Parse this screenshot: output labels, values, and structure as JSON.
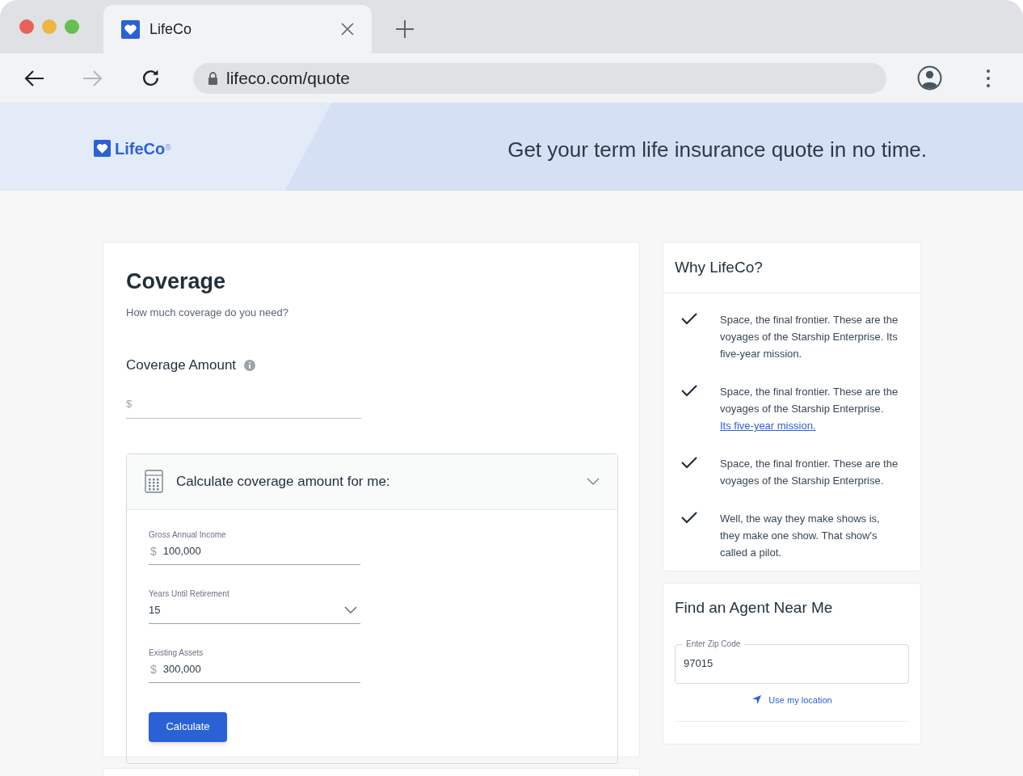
{
  "browser": {
    "tabs": [
      {
        "title": "LifeCo",
        "selected": true
      }
    ],
    "url": "lifeco.com/quote"
  },
  "header": {
    "brand": "LifeCo",
    "brand_mark": "®",
    "tagline": "Get your term life insurance quote in no time."
  },
  "coverage": {
    "title": "Coverage",
    "subtitle": "How much coverage do you need?",
    "amount_label": "Coverage Amount",
    "amount_field": {
      "prefix": "$"
    },
    "calculator": {
      "title": "Calculate coverage amount for me:",
      "expanded": true,
      "fields": [
        {
          "kind": "currency",
          "label": "Gross Annual Income",
          "prefix": "$",
          "value": "100,000"
        },
        {
          "kind": "select",
          "label": "Years Until Retirement",
          "value": "15"
        },
        {
          "kind": "currency",
          "label": "Existing Assets",
          "prefix": "$",
          "value": "300,000"
        }
      ],
      "button": "Calculate"
    }
  },
  "why": {
    "title": "Why LifeCo?",
    "items": [
      {
        "text": "Space, the final frontier. These are the voyages of the Starship Enterprise. Its five-year mission."
      },
      {
        "text": "Space, the final frontier. These are the voyages of the Starship Enterprise.",
        "link": "Its five-year mission."
      },
      {
        "text": "Space, the final frontier. These are the voyages of the Starship Enterprise."
      },
      {
        "text": "Well, the way they make shows is, they make one show. That show's called a pilot."
      }
    ]
  },
  "agent": {
    "title": "Find an Agent Near Me",
    "zip": {
      "label": "Enter Zip Code",
      "value": "97015"
    },
    "location_link": "Use my location"
  }
}
